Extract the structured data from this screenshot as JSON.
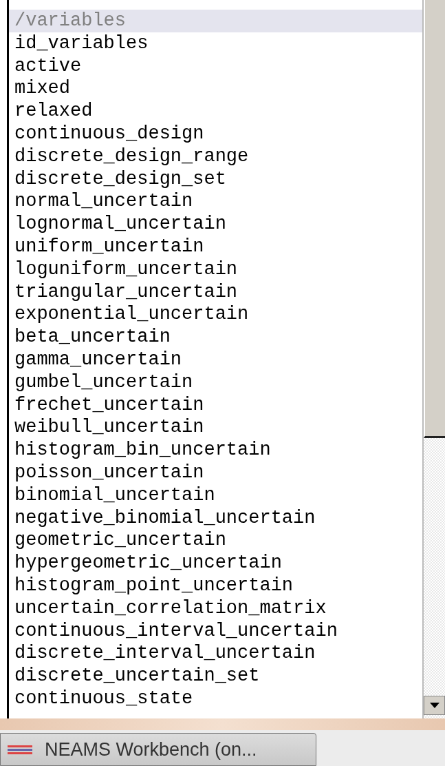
{
  "list": {
    "items": [
      {
        "label": "/variables",
        "selected": true
      },
      {
        "label": "id_variables",
        "selected": false
      },
      {
        "label": "active",
        "selected": false
      },
      {
        "label": "mixed",
        "selected": false
      },
      {
        "label": "relaxed",
        "selected": false
      },
      {
        "label": "continuous_design",
        "selected": false
      },
      {
        "label": "discrete_design_range",
        "selected": false
      },
      {
        "label": "discrete_design_set",
        "selected": false
      },
      {
        "label": "normal_uncertain",
        "selected": false
      },
      {
        "label": "lognormal_uncertain",
        "selected": false
      },
      {
        "label": "uniform_uncertain",
        "selected": false
      },
      {
        "label": "loguniform_uncertain",
        "selected": false
      },
      {
        "label": "triangular_uncertain",
        "selected": false
      },
      {
        "label": "exponential_uncertain",
        "selected": false
      },
      {
        "label": "beta_uncertain",
        "selected": false
      },
      {
        "label": "gamma_uncertain",
        "selected": false
      },
      {
        "label": "gumbel_uncertain",
        "selected": false
      },
      {
        "label": "frechet_uncertain",
        "selected": false
      },
      {
        "label": "weibull_uncertain",
        "selected": false
      },
      {
        "label": "histogram_bin_uncertain",
        "selected": false
      },
      {
        "label": "poisson_uncertain",
        "selected": false
      },
      {
        "label": "binomial_uncertain",
        "selected": false
      },
      {
        "label": "negative_binomial_uncertain",
        "selected": false
      },
      {
        "label": "geometric_uncertain",
        "selected": false
      },
      {
        "label": "hypergeometric_uncertain",
        "selected": false
      },
      {
        "label": "histogram_point_uncertain",
        "selected": false
      },
      {
        "label": "uncertain_correlation_matrix",
        "selected": false
      },
      {
        "label": "continuous_interval_uncertain",
        "selected": false
      },
      {
        "label": "discrete_interval_uncertain",
        "selected": false
      },
      {
        "label": "discrete_uncertain_set",
        "selected": false
      },
      {
        "label": "continuous_state",
        "selected": false
      }
    ]
  },
  "taskbar": {
    "button": {
      "label": "NEAMS Workbench (on..."
    }
  }
}
